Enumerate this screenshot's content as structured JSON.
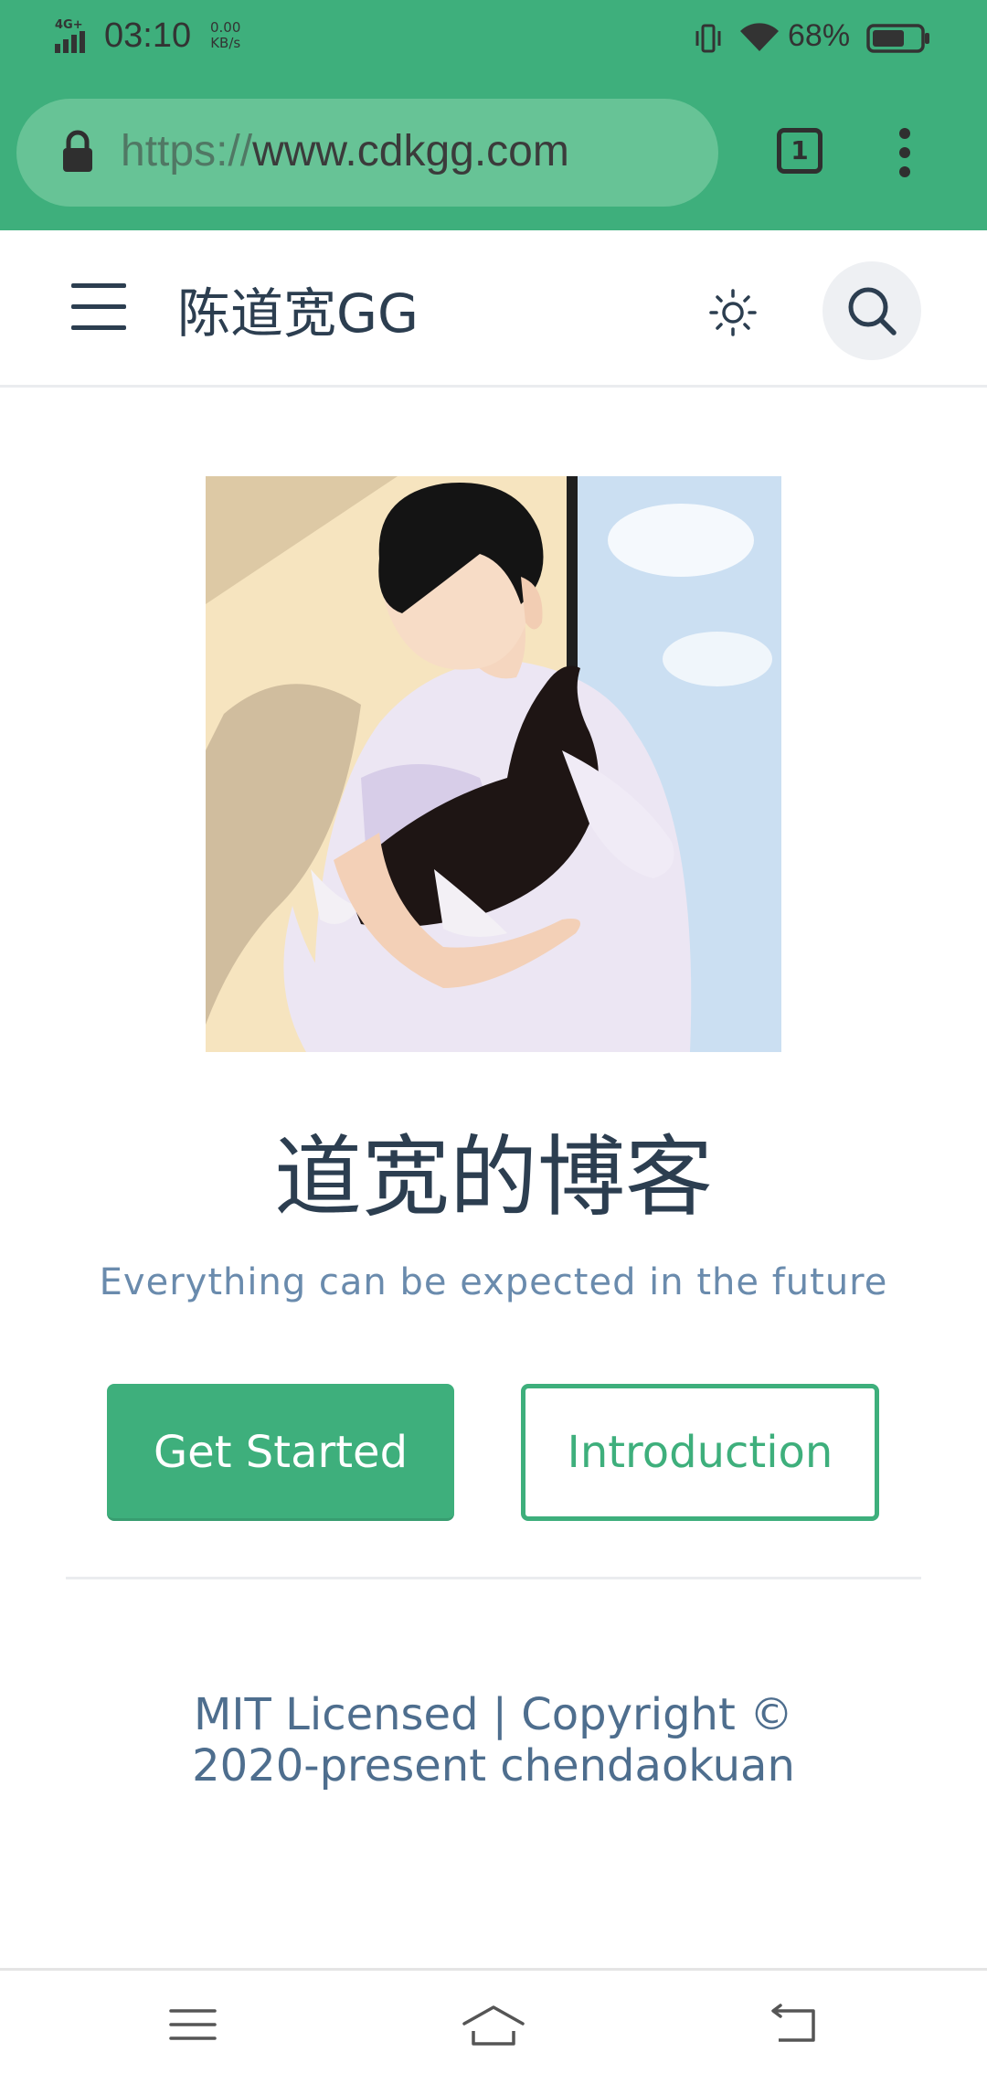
{
  "status_bar": {
    "network": "4G+",
    "time": "03:10",
    "speed_value": "0.00",
    "speed_unit": "KB/s",
    "battery_percent": "68%",
    "battery_level": 0.68
  },
  "browser": {
    "url_scheme": "https://",
    "url_host": "www.cdkgg.com",
    "tab_count": "1"
  },
  "navbar": {
    "site_title": "陈道宽GG"
  },
  "hero": {
    "title": "道宽的博客",
    "tagline": "Everything can be expected in the future",
    "primary_button": "Get Started",
    "secondary_button": "Introduction"
  },
  "footer": {
    "line1": "MIT Licensed | Copyright ©",
    "line2": "2020-present chendaokuan"
  },
  "colors": {
    "accent": "#3eaf7c",
    "text": "#2c3e50",
    "tagline": "#6a8bad"
  }
}
